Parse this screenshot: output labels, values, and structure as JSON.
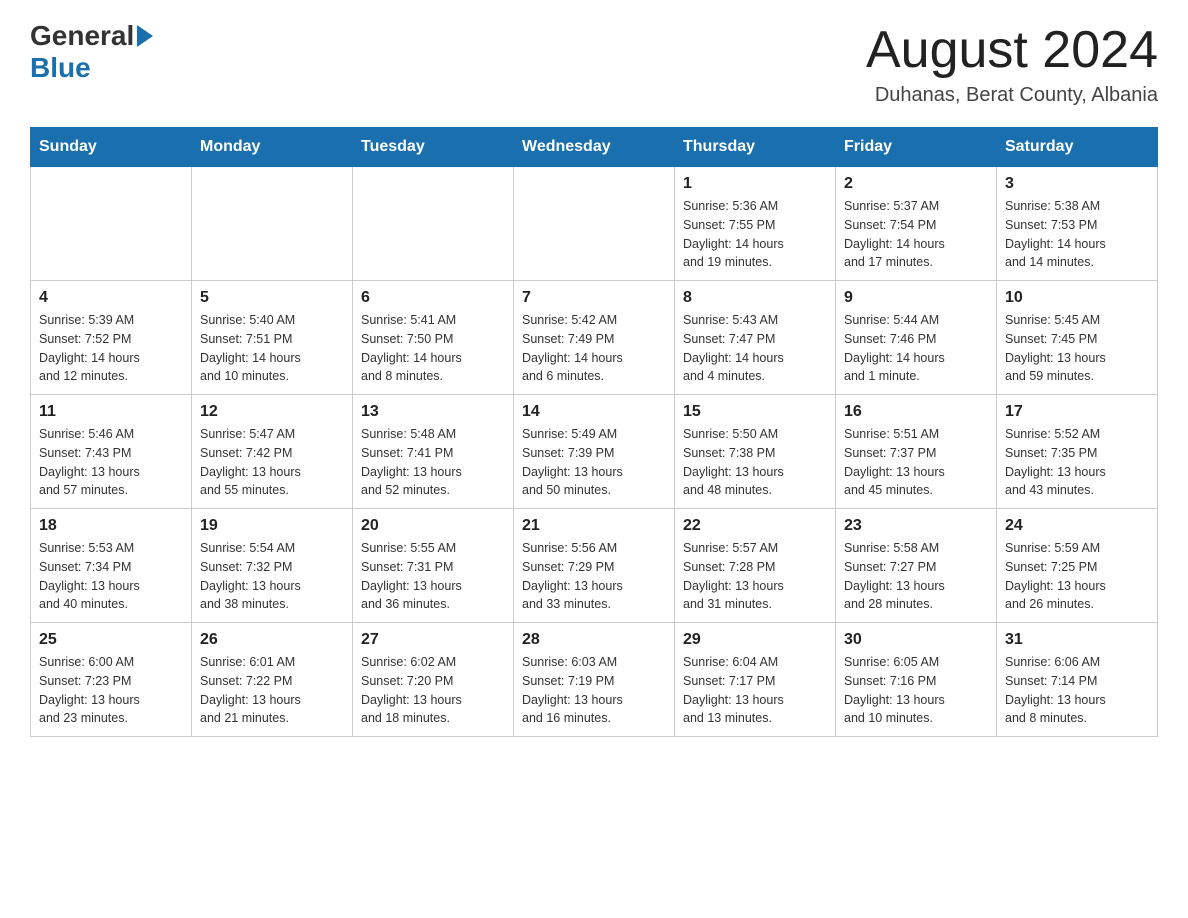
{
  "header": {
    "logo_general": "General",
    "logo_blue": "Blue",
    "title": "August 2024",
    "location": "Duhanas, Berat County, Albania"
  },
  "weekdays": [
    "Sunday",
    "Monday",
    "Tuesday",
    "Wednesday",
    "Thursday",
    "Friday",
    "Saturday"
  ],
  "weeks": [
    [
      {
        "day": "",
        "info": ""
      },
      {
        "day": "",
        "info": ""
      },
      {
        "day": "",
        "info": ""
      },
      {
        "day": "",
        "info": ""
      },
      {
        "day": "1",
        "info": "Sunrise: 5:36 AM\nSunset: 7:55 PM\nDaylight: 14 hours\nand 19 minutes."
      },
      {
        "day": "2",
        "info": "Sunrise: 5:37 AM\nSunset: 7:54 PM\nDaylight: 14 hours\nand 17 minutes."
      },
      {
        "day": "3",
        "info": "Sunrise: 5:38 AM\nSunset: 7:53 PM\nDaylight: 14 hours\nand 14 minutes."
      }
    ],
    [
      {
        "day": "4",
        "info": "Sunrise: 5:39 AM\nSunset: 7:52 PM\nDaylight: 14 hours\nand 12 minutes."
      },
      {
        "day": "5",
        "info": "Sunrise: 5:40 AM\nSunset: 7:51 PM\nDaylight: 14 hours\nand 10 minutes."
      },
      {
        "day": "6",
        "info": "Sunrise: 5:41 AM\nSunset: 7:50 PM\nDaylight: 14 hours\nand 8 minutes."
      },
      {
        "day": "7",
        "info": "Sunrise: 5:42 AM\nSunset: 7:49 PM\nDaylight: 14 hours\nand 6 minutes."
      },
      {
        "day": "8",
        "info": "Sunrise: 5:43 AM\nSunset: 7:47 PM\nDaylight: 14 hours\nand 4 minutes."
      },
      {
        "day": "9",
        "info": "Sunrise: 5:44 AM\nSunset: 7:46 PM\nDaylight: 14 hours\nand 1 minute."
      },
      {
        "day": "10",
        "info": "Sunrise: 5:45 AM\nSunset: 7:45 PM\nDaylight: 13 hours\nand 59 minutes."
      }
    ],
    [
      {
        "day": "11",
        "info": "Sunrise: 5:46 AM\nSunset: 7:43 PM\nDaylight: 13 hours\nand 57 minutes."
      },
      {
        "day": "12",
        "info": "Sunrise: 5:47 AM\nSunset: 7:42 PM\nDaylight: 13 hours\nand 55 minutes."
      },
      {
        "day": "13",
        "info": "Sunrise: 5:48 AM\nSunset: 7:41 PM\nDaylight: 13 hours\nand 52 minutes."
      },
      {
        "day": "14",
        "info": "Sunrise: 5:49 AM\nSunset: 7:39 PM\nDaylight: 13 hours\nand 50 minutes."
      },
      {
        "day": "15",
        "info": "Sunrise: 5:50 AM\nSunset: 7:38 PM\nDaylight: 13 hours\nand 48 minutes."
      },
      {
        "day": "16",
        "info": "Sunrise: 5:51 AM\nSunset: 7:37 PM\nDaylight: 13 hours\nand 45 minutes."
      },
      {
        "day": "17",
        "info": "Sunrise: 5:52 AM\nSunset: 7:35 PM\nDaylight: 13 hours\nand 43 minutes."
      }
    ],
    [
      {
        "day": "18",
        "info": "Sunrise: 5:53 AM\nSunset: 7:34 PM\nDaylight: 13 hours\nand 40 minutes."
      },
      {
        "day": "19",
        "info": "Sunrise: 5:54 AM\nSunset: 7:32 PM\nDaylight: 13 hours\nand 38 minutes."
      },
      {
        "day": "20",
        "info": "Sunrise: 5:55 AM\nSunset: 7:31 PM\nDaylight: 13 hours\nand 36 minutes."
      },
      {
        "day": "21",
        "info": "Sunrise: 5:56 AM\nSunset: 7:29 PM\nDaylight: 13 hours\nand 33 minutes."
      },
      {
        "day": "22",
        "info": "Sunrise: 5:57 AM\nSunset: 7:28 PM\nDaylight: 13 hours\nand 31 minutes."
      },
      {
        "day": "23",
        "info": "Sunrise: 5:58 AM\nSunset: 7:27 PM\nDaylight: 13 hours\nand 28 minutes."
      },
      {
        "day": "24",
        "info": "Sunrise: 5:59 AM\nSunset: 7:25 PM\nDaylight: 13 hours\nand 26 minutes."
      }
    ],
    [
      {
        "day": "25",
        "info": "Sunrise: 6:00 AM\nSunset: 7:23 PM\nDaylight: 13 hours\nand 23 minutes."
      },
      {
        "day": "26",
        "info": "Sunrise: 6:01 AM\nSunset: 7:22 PM\nDaylight: 13 hours\nand 21 minutes."
      },
      {
        "day": "27",
        "info": "Sunrise: 6:02 AM\nSunset: 7:20 PM\nDaylight: 13 hours\nand 18 minutes."
      },
      {
        "day": "28",
        "info": "Sunrise: 6:03 AM\nSunset: 7:19 PM\nDaylight: 13 hours\nand 16 minutes."
      },
      {
        "day": "29",
        "info": "Sunrise: 6:04 AM\nSunset: 7:17 PM\nDaylight: 13 hours\nand 13 minutes."
      },
      {
        "day": "30",
        "info": "Sunrise: 6:05 AM\nSunset: 7:16 PM\nDaylight: 13 hours\nand 10 minutes."
      },
      {
        "day": "31",
        "info": "Sunrise: 6:06 AM\nSunset: 7:14 PM\nDaylight: 13 hours\nand 8 minutes."
      }
    ]
  ]
}
